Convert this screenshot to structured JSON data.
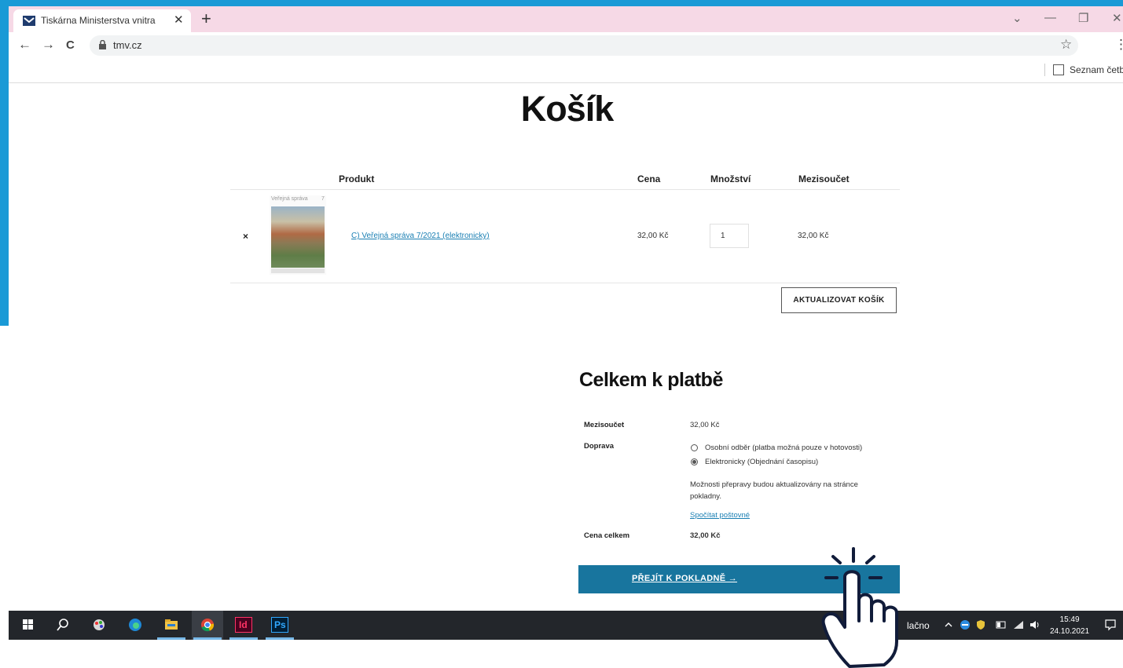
{
  "browser": {
    "tab_title": "Tiskárna Ministerstva vnitra",
    "tab_close": "✕",
    "new_tab": "+",
    "url": "tmv.cz",
    "back": "←",
    "forward": "→",
    "reload": "C",
    "bookmark_star": "☆",
    "menu": "⋮",
    "reading_list": "Seznam četby",
    "window_controls": {
      "chevron": "⌄",
      "minimize": "—",
      "restore": "❐",
      "close": "✕"
    }
  },
  "page": {
    "title": "Košík",
    "cart": {
      "headers": {
        "product": "Produkt",
        "price": "Cena",
        "quantity": "Množství",
        "subtotal": "Mezisoučet"
      },
      "items": [
        {
          "remove": "×",
          "thumb_header": "Veřejná správa",
          "thumb_number": "7",
          "name": "C) Veřejná správa 7/2021 (elektronicky)",
          "price": "32,00 Kč",
          "quantity": "1",
          "subtotal": "32,00 Kč"
        }
      ],
      "update_button": "AKTUALIZOVAT KOŠÍK"
    },
    "totals": {
      "title": "Celkem k platbě",
      "subtotal_label": "Mezisoučet",
      "subtotal_value": "32,00 Kč",
      "shipping_label": "Doprava",
      "shipping_options": [
        {
          "label": "Osobní odběr (platba možná pouze v hotovosti)",
          "selected": false
        },
        {
          "label": "Elektronicky (Objednání časopisu)",
          "selected": true
        }
      ],
      "shipping_note": "Možnosti přepravy budou aktualizovány na stránce pokladny.",
      "calculate_link": "Spočítat poštovné",
      "total_label": "Cena celkem",
      "total_value": "32,00 Kč",
      "checkout_button": "PŘEJÍT K POKLADNĚ →"
    }
  },
  "taskbar": {
    "apps": [
      "windows-start",
      "search",
      "paint",
      "edge",
      "file-explorer",
      "chrome",
      "indesign",
      "photoshop"
    ],
    "indesign_label": "Id",
    "photoshop_label": "Ps",
    "partial_text": "lačno",
    "time": "15:49",
    "date": "24.10.2021"
  },
  "colors": {
    "accent_blue": "#1a9ad6",
    "tab_strip": "#f6d9e6",
    "checkout": "#18759e",
    "link": "#1a7fb3",
    "taskbar": "#23262b"
  }
}
